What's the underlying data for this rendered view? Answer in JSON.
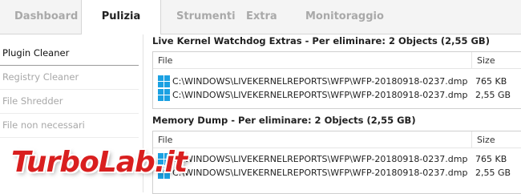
{
  "tabs": [
    {
      "label": "Dashboard"
    },
    {
      "label": "Pulizia"
    },
    {
      "label": "Strumenti"
    },
    {
      "label": "Extra"
    },
    {
      "label": "Monitoraggio"
    }
  ],
  "sidebar": {
    "items": [
      {
        "label": "Plugin Cleaner"
      },
      {
        "label": "Registry Cleaner"
      },
      {
        "label": "File Shredder"
      },
      {
        "label": "File non necessari"
      }
    ]
  },
  "sections": [
    {
      "title": "Live Kernel Watchdog Extras - Per eliminare: 2 Objects (2,55 GB)",
      "col_file": "File",
      "col_size": "Size",
      "rows": [
        {
          "path": "C:\\WINDOWS\\LIVEKERNELREPORTS\\WFP\\WFP-20180918-0237.dmp",
          "size": "765 KB",
          "icon": "windows-icon"
        },
        {
          "path": "C:\\WINDOWS\\LIVEKERNELREPORTS\\WFP\\WFP-20180918-0237.dmp",
          "size": "2,55 GB",
          "icon": "windows-icon"
        }
      ]
    },
    {
      "title": "Memory Dump - Per eliminare: 2 Objects (2,55 GB)",
      "col_file": "File",
      "col_size": "Size",
      "rows": [
        {
          "path": "C:\\WINDOWS\\LIVEKERNELREPORTS\\WFP\\WFP-20180918-0237.dmp",
          "size": "765 KB",
          "icon": "windows-icon"
        },
        {
          "path": "C:\\WINDOWS\\LIVEKERNELREPORTS\\WFP\\WFP-20180918-0237.dmp",
          "size": "2,55 GB",
          "icon": "windows-icon"
        }
      ]
    }
  ],
  "watermark": {
    "text": "TurboLab.it"
  },
  "colors": {
    "accent": "#1ba1e2",
    "watermark": "#d91f1f",
    "inactive_text": "#a8a8a8"
  }
}
